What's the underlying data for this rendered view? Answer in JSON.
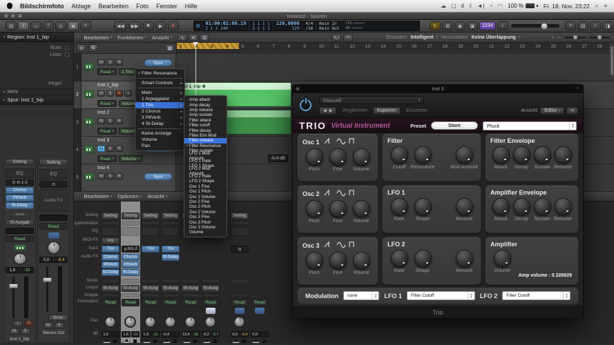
{
  "menubar": {
    "app_name": "Bildschirmfoto",
    "menus": [
      "Ablage",
      "Bearbeiten",
      "Foto",
      "Fenster",
      "Hilfe"
    ],
    "status_icons": [
      {
        "name": "creative-cloud-icon",
        "glyph": "☁"
      },
      {
        "name": "display-icon",
        "glyph": "▢"
      },
      {
        "name": "docker-icon",
        "glyph": "d"
      },
      {
        "name": "bluetooth-icon",
        "glyph": "ᛒ"
      },
      {
        "name": "volume-icon",
        "glyph": "◄)"
      },
      {
        "name": "time-machine-icon",
        "glyph": "◔"
      },
      {
        "name": "wifi-icon",
        "glyph": "◠"
      }
    ],
    "battery": "100 %",
    "clock": "Fr. 18. Nov.  23:22"
  },
  "window": {
    "title": "triotest2 - Spuren"
  },
  "icons": {
    "check": "✓",
    "arrow": "▸",
    "chevron": "▾",
    "disclosure_open": "▾",
    "disclosure_closed": "▸",
    "stereo": "⊙",
    "region_badge": "⊕",
    "close": "⊗",
    "minimize": "—",
    "link": "∞",
    "search": "⌕",
    "control_center": "≡",
    "hide": "↑",
    "plus": "+",
    "duplicate": "⧉",
    "grid": "▦",
    "pointer_tool": "↖",
    "cross_tool": "+"
  },
  "control_bar": {
    "left_buttons": [
      {
        "name": "library-button",
        "glyph": "▤",
        "active": false
      },
      {
        "name": "inspector-button",
        "glyph": "i",
        "active": true
      },
      {
        "name": "toolbar-button",
        "glyph": "▭",
        "active": false
      },
      {
        "name": "quick-help-button",
        "glyph": "?",
        "active": false
      },
      {
        "name": "smart-controls-button",
        "glyph": "◎",
        "active": false
      },
      {
        "name": "mixer-button",
        "glyph": "≣",
        "active": true
      },
      {
        "name": "editors-button",
        "glyph": "×",
        "active": false
      }
    ],
    "transport_buttons": [
      {
        "name": "rewind-button",
        "glyph": "◀◀",
        "cls": ""
      },
      {
        "name": "forward-button",
        "glyph": "▶▶",
        "cls": ""
      },
      {
        "name": "stop-button",
        "glyph": "■",
        "cls": ""
      },
      {
        "name": "play-button",
        "glyph": "▶",
        "cls": ""
      },
      {
        "name": "record-button",
        "glyph": "●",
        "cls": "rec"
      }
    ],
    "mode_buttons": [
      {
        "name": "cycle-button",
        "glyph": "↻",
        "cls": "amber"
      },
      {
        "name": "autopunch-button",
        "glyph": "⊠",
        "cls": ""
      },
      {
        "name": "replace-button",
        "glyph": "◉",
        "cls": ""
      },
      {
        "name": "low-latency-button",
        "glyph": "▣",
        "cls": ""
      },
      {
        "name": "count-in-button",
        "glyph": "1234",
        "cls": "purple"
      },
      {
        "name": "metronome-button",
        "glyph": "♪",
        "cls": "lav"
      }
    ],
    "right_buttons": [
      {
        "name": "list-editors-button",
        "glyph": "≡"
      },
      {
        "name": "note-pads-button",
        "glyph": "▤"
      },
      {
        "name": "loop-browser-button",
        "glyph": "⌕"
      },
      {
        "name": "browsers-button",
        "glyph": "◨"
      }
    ]
  },
  "transport": {
    "smpte": "01:00:02:06.19",
    "position": "2 1 2 240",
    "cycle_top": "1 1 1 1",
    "cycle_bottom": "5 1 1 1",
    "tempo": "120,0000",
    "tempo_sub": "129",
    "signature": "4/4",
    "division": "/16",
    "midi_in": "Kein In",
    "midi_out": "Kein Out",
    "cpu_label": "CPU",
    "hd_label": "HD"
  },
  "inspector": {
    "region_title": "Region: Inst 1_bip",
    "mute_label": "Mute:",
    "loop_label": "Loop:",
    "dots_placeholder": "· ·",
    "pegel_label": "Pegel:",
    "more_label": "Mehr",
    "track_title": "Spur: Inst 1_bip",
    "strip1": {
      "setting": "Setting",
      "eq": "EQ",
      "input": "In 1-2",
      "fx": [
        "Chorus",
        "PltVerb",
        "St-Delay"
      ],
      "send": "Send",
      "output": "St-Ausgab",
      "automation": "Read",
      "volume": "1,6",
      "peak": "-10",
      "input_monitor": "I",
      "record": "R",
      "mute": "M",
      "solo": "S",
      "name": "Inst 1_bip"
    },
    "strip2": {
      "setting": "Setting",
      "eq": "EQ",
      "audio_fx": "Audio FX",
      "automation": "Read",
      "volume": "0,0",
      "peak": "-6,4",
      "bounce": "Bnce",
      "mute": "M",
      "solo": "S",
      "name": "Stereo Out"
    }
  },
  "track_panel": {
    "menus": [
      "Bearbeiten",
      "Funktionen",
      "Ansicht"
    ],
    "header_tool_icons": [
      "∿",
      "≋",
      "⊞"
    ],
    "snap_label": "Einrasten:",
    "snap_value": "Intelligent",
    "drag_label": "Verschieben:",
    "drag_value": "Keine Überlappung",
    "zoom_icons": [
      "↕",
      "↔"
    ],
    "ruler_start": 1,
    "ruler_end": 28,
    "tracks": [
      {
        "num": "1",
        "name": "",
        "mute": "M",
        "solo": "S",
        "rec": "R",
        "spur": "Spur",
        "auto_mode": "Read",
        "auto_param": "1 Trio: F",
        "selected": false,
        "dots": true
      },
      {
        "num": "2",
        "name": "Inst 1_bip",
        "mute": "M",
        "solo": "S",
        "rec": "R",
        "input_mon": "I",
        "rec_colored": true,
        "spur": "Spur",
        "auto_mode": "Read",
        "auto_param": "Volume",
        "selected": true,
        "region": {
          "name": "Inst 1_bip",
          "style": "bright"
        }
      },
      {
        "num": "3",
        "name": "Inst 2",
        "mute": "M",
        "solo": "S",
        "rec": "R",
        "spur": "Spur",
        "auto_mode": "Read",
        "auto_param": "Volume",
        "selected": false,
        "region": {
          "name": "",
          "style": "dim"
        }
      },
      {
        "num": "4",
        "name": "Inst 3",
        "mute": "M",
        "solo": "S",
        "rec": "R",
        "mute_active": true,
        "spur": "Spur",
        "auto_mode": "Read",
        "auto_param": "Volume",
        "auto_value": "-0,4 dB",
        "selected": false
      },
      {
        "num": "5",
        "name": "Inst 4",
        "mute": "M",
        "solo": "S",
        "rec": "R",
        "spur": "Spur",
        "selected": false
      }
    ]
  },
  "context_menu": {
    "items": [
      {
        "label": "Filter Resonance",
        "checked": true
      },
      {
        "type": "sep"
      },
      {
        "label": "Smart Controls",
        "arrow": true
      },
      {
        "type": "sep"
      },
      {
        "label": "Main",
        "arrow": true
      },
      {
        "label": "1 Arpeggiator",
        "arrow": true
      },
      {
        "label": "1 Trio",
        "arrow": true,
        "selected": true
      },
      {
        "label": "2 Chorus",
        "arrow": true
      },
      {
        "label": "3 PltVerb",
        "arrow": true
      },
      {
        "label": "4 St-Delay",
        "arrow": true
      },
      {
        "type": "sep"
      },
      {
        "label": "Keine Anzeige"
      },
      {
        "label": "Volume"
      },
      {
        "label": "Pan"
      }
    ]
  },
  "param_submenu": {
    "items": [
      "Amp attack",
      "Amp decay",
      "Amp release",
      "Amp sustain",
      "Filter attack",
      "Filter cutoff",
      "Filter decay",
      "Filter Env Mod",
      "Filter release",
      "Filter Resonance",
      "Filter sustain",
      "LFO 1 Mod Amount",
      "LFO 1 Rate",
      "LFO 1 Shape",
      "LFO 2 Mod Amount",
      "LFO 2 Rate",
      "LFO 2 Shape",
      "Osc 1 Fine",
      "Osc 1 Pitch",
      "Osc 1 Volume",
      "Osc 2 Fine",
      "Osc 2 Pitch",
      "Osc 2 Volume",
      "Osc 3 Fine",
      "Osc 3 Pitch",
      "Osc 3 Volume",
      "Volume"
    ],
    "highlighted": "Filter release",
    "checked": "Filter Resonance"
  },
  "mixer": {
    "menus": [
      "Bearbeiten",
      "Optionen",
      "Ansicht"
    ],
    "view_icons": [
      "▤",
      "▦"
    ],
    "row_labels": [
      "Setting",
      "Pegelreduktion",
      "EQ",
      "MIDI-FX",
      "Input",
      "Audio FX",
      "Sends",
      "Output",
      "Gruppe",
      "Automation",
      "Pan",
      "dB"
    ],
    "strips": [
      {
        "setting": "Setting",
        "midi_fx": "Arp",
        "input": "Trio",
        "input_blue": true,
        "fx": [
          "Chorus",
          "PltVerb",
          "St-Delay"
        ],
        "output": "St-Ausg",
        "automation": "Read",
        "db": "1,6",
        "peak": "",
        "icon": "instrument",
        "selected": false,
        "has_pan": true
      },
      {
        "setting": "Setting",
        "input": "In1-2",
        "input_icon": true,
        "input_blue": false,
        "fx": [
          "Chorus",
          "PltVerb",
          "St-Delay"
        ],
        "output": "St-Ausg",
        "automation": "Read",
        "db": "1,6",
        "peak": "-11",
        "icon": "instrument",
        "selected": true,
        "has_pan": true
      },
      {
        "setting": "Setting",
        "input": "Trio",
        "input_blue": true,
        "fx": [],
        "output": "St-Ausg",
        "automation": "Read",
        "db": "1,9",
        "peak": "-11",
        "icon": "instrument",
        "selected": false,
        "has_pan": true
      },
      {
        "setting": "Setting",
        "input": "Trio",
        "input_blue": true,
        "fx": [
          "St-Delay"
        ],
        "output": "St-Ausg",
        "automation": "Read",
        "db": "-0,4",
        "peak": "",
        "icon": "instrument",
        "selected": false,
        "has_pan": true
      },
      {
        "setting": "Setting",
        "input": "",
        "fx": [],
        "output": "St-Ausg",
        "automation": "Read",
        "db": "13,4",
        "peak": "-18",
        "icon": "instrument",
        "selected": false,
        "has_pan": true
      },
      {
        "setting": "Setting",
        "input": "",
        "fx": [],
        "output": "St-Ausg",
        "automation": "Read",
        "db": "-6,2",
        "peak": "-2,7",
        "icon": "patch",
        "selected": false,
        "has_pan": true
      },
      {
        "setting": "Setting",
        "input": "",
        "input_icon": true,
        "fx": [],
        "output": "",
        "automation": "Read",
        "db": "0,0",
        "peak": "-0,4",
        "peak_warn": true,
        "icon": "output",
        "selected": false,
        "has_pan": true
      },
      {
        "bare": true,
        "automation": "Read",
        "db": "0,0",
        "peak": "",
        "icon": "output",
        "selected": false,
        "has_pan": false
      }
    ]
  },
  "plugin": {
    "title": "Inst 3",
    "preset_dropdown": "Manuell",
    "prev": "◀",
    "next": "▶",
    "compare": "Vergleichen",
    "copy": "Kopieren",
    "paste": "Einsetzen",
    "view_label": "Ansicht:",
    "view_value": "Editor",
    "brand": "TRIO",
    "tagline": "Virtual Instrument",
    "preset_label": "Preset",
    "store": "Store",
    "preset_value": "Pluck",
    "sections": [
      {
        "title": "Osc 1",
        "waves": true,
        "layout": "osc",
        "knobs": [
          "Pitch",
          "Fine",
          "Volume"
        ]
      },
      {
        "title": "Filter",
        "layout": "triple",
        "knobs": [
          "Cutoff",
          "Resonance",
          "Mod.Amount"
        ]
      },
      {
        "title": "Filter Envelope",
        "layout": "spread",
        "knobs": [
          "Attack",
          "Decay",
          "Sustain",
          "Release"
        ]
      },
      {
        "title": "Osc 2",
        "waves": true,
        "layout": "osc",
        "knobs": [
          "Pitch",
          "Fine",
          "Volume"
        ]
      },
      {
        "title": "LFO 1",
        "layout": "triple",
        "knobs": [
          "Rate",
          "Shape",
          "Amount"
        ]
      },
      {
        "title": "Amplifier Envelope",
        "layout": "spread",
        "knobs": [
          "Attack",
          "Decay",
          "Sustain",
          "Release"
        ]
      },
      {
        "title": "Osc 3",
        "waves": true,
        "layout": "osc",
        "knobs": [
          "Pitch",
          "Fine",
          "Volume"
        ]
      },
      {
        "title": "LFO 2",
        "layout": "triple",
        "knobs": [
          "Rate",
          "Shape",
          "Amount"
        ]
      },
      {
        "title": "Amplifier",
        "layout": "amp",
        "knobs": [
          "Volume"
        ],
        "readout": "Amp volume : 0.326829"
      }
    ],
    "mod_label": "Modulation",
    "mod_value": "none",
    "lfo1_label": "LFO 1",
    "lfo1_value": "Filter Cutoff",
    "lfo2_label": "LFO 2",
    "lfo2_value": "Filter Cutoff",
    "footer": "Trio"
  }
}
